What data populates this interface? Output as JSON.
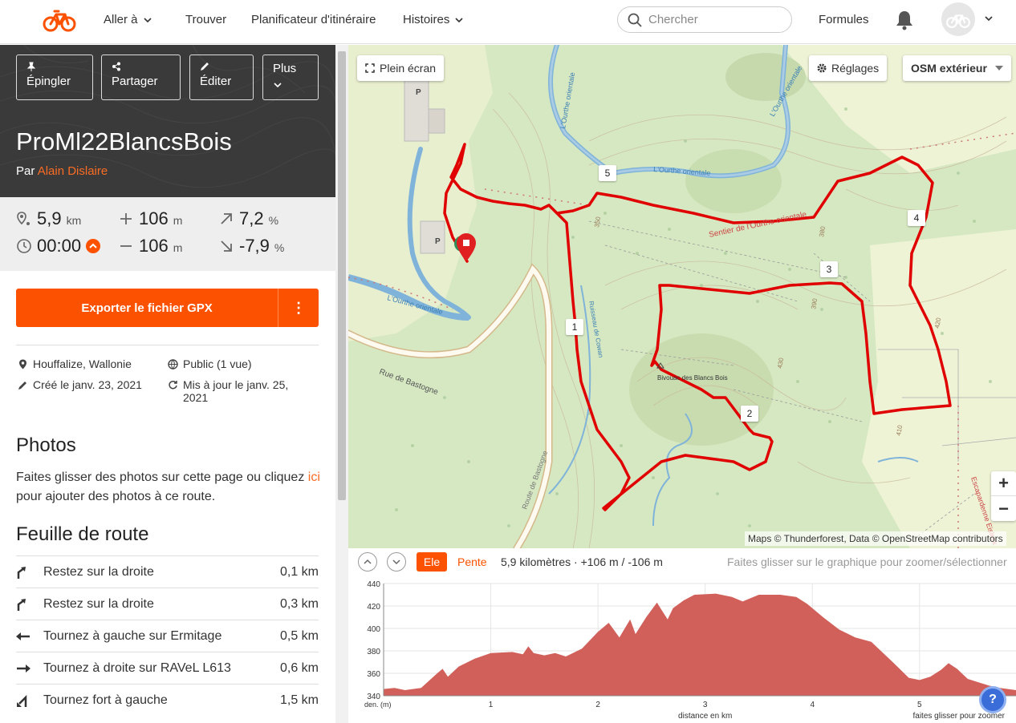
{
  "nav": {
    "items": [
      "Aller à",
      "Trouver",
      "Planificateur d'itinéraire",
      "Histoires"
    ],
    "search_placeholder": "Chercher",
    "formules": "Formules"
  },
  "actions": {
    "pin": "Épingler",
    "share": "Partager",
    "edit": "Éditer",
    "more": "Plus"
  },
  "route": {
    "title": "ProMl22BlancsBois",
    "by": "Par",
    "author": "Alain Dislaire"
  },
  "stats": {
    "distance": "5,9",
    "distance_unit": "km",
    "ascent": "106",
    "ascent_unit": "m",
    "grade_up": "7,2",
    "grade_up_unit": "%",
    "time": "00:00",
    "descent": "106",
    "descent_unit": "m",
    "grade_down": "-7,9",
    "grade_down_unit": "%"
  },
  "export": {
    "label": "Exporter le fichier GPX",
    "more": "⋮"
  },
  "meta": {
    "location": "Houffalize, Wallonie",
    "visibility": "Public (1 vue)",
    "created": "Créé le janv. 23, 2021",
    "updated": "Mis à jour le janv. 25, 2021"
  },
  "photos": {
    "heading": "Photos",
    "text_before": "Faites glisser des photos sur cette page ou cliquez",
    "link": "ici",
    "text_after": "pour ajouter des photos à ce route."
  },
  "cuesheet": {
    "heading": "Feuille de route",
    "items": [
      {
        "text": "Restez sur la droite",
        "dist": "0,1 km",
        "icon": "bear-right-icon"
      },
      {
        "text": "Restez sur la droite",
        "dist": "0,3 km",
        "icon": "bear-right-icon"
      },
      {
        "text": "Tournez à gauche sur Ermitage",
        "dist": "0,5 km",
        "icon": "turn-left-icon"
      },
      {
        "text": "Tournez à droite sur RAVeL L613",
        "dist": "0,6 km",
        "icon": "turn-right-icon"
      },
      {
        "text": "Tournez fort à gauche",
        "dist": "1,5 km",
        "icon": "sharp-left-icon"
      }
    ]
  },
  "map": {
    "fullscreen": "Plein écran",
    "settings": "Réglages",
    "layer": "OSM extérieur",
    "attribution": "Maps © Thunderforest, Data © OpenStreetMap contributors",
    "waypoints": [
      "1",
      "2",
      "3",
      "4",
      "5"
    ],
    "labels": {
      "bivouac": "Bivouac des Blancs Bois",
      "sentier": "Sentier de l'Ourthe orientale",
      "rue_bastogne": "Rue de Bastogne",
      "route_bastogne": "Route de Bastogne",
      "ourthe1": "L'Ourthe orientale",
      "ourthe2": "L'Ourthe orientale",
      "ourthe3": "L'Ourthe orientale",
      "ourthe4": "L'Ourthe orientale",
      "ruisseau": "Ruisseau de Cowan",
      "escapardenne": "Escapardenne Eisleck",
      "alt350": "350",
      "alt380": "380",
      "alt390": "390",
      "alt420": "420",
      "alt430": "430",
      "alt410": "410",
      "parking": "P"
    },
    "colors": {
      "route": "#e00000",
      "accent": "#fc5200"
    }
  },
  "elevation": {
    "ele_tab": "Ele",
    "pente_tab": "Pente",
    "summary": "5,9 kilomètres · +106 m / -106 m",
    "hint": "Faites glisser sur le graphique pour zoomer/sélectionner",
    "ylabel": "den. (m)",
    "xlabel": "distance en km",
    "footer_hint": "faites glisser pour zoomer"
  },
  "chart_data": {
    "type": "area",
    "xlabel": "distance en km",
    "ylabel": "den. (m)",
    "ylim": [
      340,
      440
    ],
    "xlim": [
      0,
      5.9
    ],
    "yticks": [
      340,
      360,
      380,
      400,
      420,
      440
    ],
    "xticks": [
      1,
      2,
      3,
      4,
      5
    ],
    "grid": true,
    "series": [
      {
        "values": [
          [
            0,
            346
          ],
          [
            0.1,
            347
          ],
          [
            0.2,
            345
          ],
          [
            0.35,
            347
          ],
          [
            0.5,
            360
          ],
          [
            0.55,
            364
          ],
          [
            0.6,
            357
          ],
          [
            0.7,
            366
          ],
          [
            0.85,
            373
          ],
          [
            1.0,
            378
          ],
          [
            1.2,
            379
          ],
          [
            1.3,
            377
          ],
          [
            1.35,
            384
          ],
          [
            1.4,
            378
          ],
          [
            1.5,
            376
          ],
          [
            1.6,
            378
          ],
          [
            1.7,
            375
          ],
          [
            1.85,
            382
          ],
          [
            2.0,
            397
          ],
          [
            2.1,
            405
          ],
          [
            2.2,
            392
          ],
          [
            2.3,
            408
          ],
          [
            2.35,
            395
          ],
          [
            2.45,
            410
          ],
          [
            2.55,
            423
          ],
          [
            2.65,
            408
          ],
          [
            2.7,
            418
          ],
          [
            2.8,
            425
          ],
          [
            2.9,
            430
          ],
          [
            3.1,
            431
          ],
          [
            3.25,
            428
          ],
          [
            3.35,
            424
          ],
          [
            3.5,
            430
          ],
          [
            3.7,
            430
          ],
          [
            3.85,
            428
          ],
          [
            3.95,
            422
          ],
          [
            4.1,
            410
          ],
          [
            4.25,
            399
          ],
          [
            4.4,
            392
          ],
          [
            4.55,
            388
          ],
          [
            4.75,
            370
          ],
          [
            4.9,
            356
          ],
          [
            5.0,
            354
          ],
          [
            5.1,
            357
          ],
          [
            5.2,
            363
          ],
          [
            5.27,
            369
          ],
          [
            5.35,
            364
          ],
          [
            5.45,
            355
          ],
          [
            5.55,
            352
          ],
          [
            5.65,
            349
          ],
          [
            5.75,
            347
          ],
          [
            5.9,
            345
          ]
        ]
      }
    ]
  }
}
